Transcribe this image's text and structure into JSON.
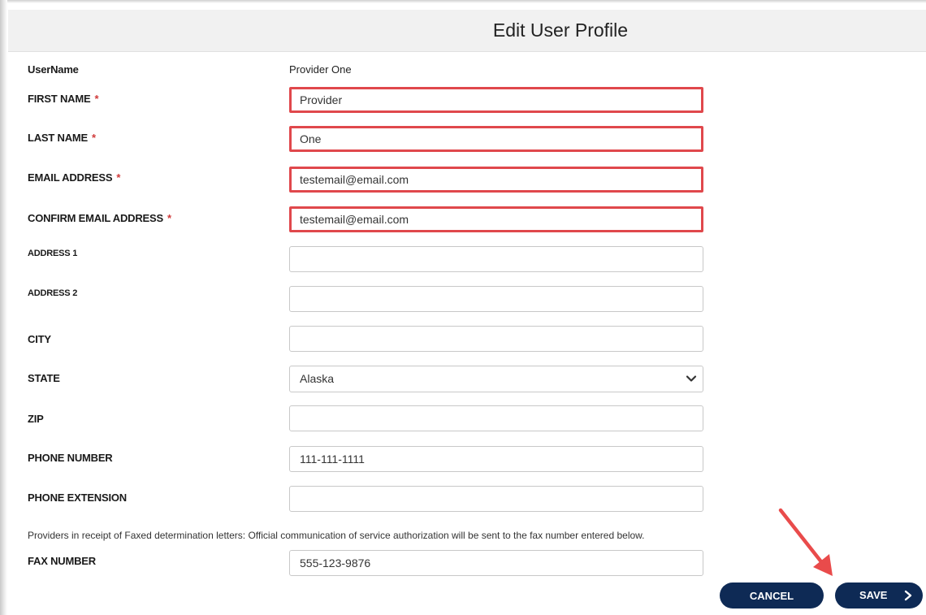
{
  "header": {
    "title": "Edit User Profile"
  },
  "form": {
    "username": {
      "label": "UserName",
      "value": "Provider One"
    },
    "first_name": {
      "label": "FIRST NAME",
      "required_mark": "*",
      "value": "Provider"
    },
    "last_name": {
      "label": "LAST NAME",
      "required_mark": "*",
      "value": "One"
    },
    "email": {
      "label": "EMAIL ADDRESS",
      "required_mark": "*",
      "value": "testemail@email.com"
    },
    "confirm_email": {
      "label": "CONFIRM EMAIL ADDRESS",
      "required_mark": "*",
      "value": "testemail@email.com"
    },
    "address1": {
      "label": "ADDRESS 1",
      "value": ""
    },
    "address2": {
      "label": "ADDRESS 2",
      "value": ""
    },
    "city": {
      "label": "CITY",
      "value": ""
    },
    "state": {
      "label": "STATE",
      "value": "Alaska"
    },
    "zip": {
      "label": "ZIP",
      "value": ""
    },
    "phone": {
      "label": "PHONE NUMBER",
      "value": "111-111-1111"
    },
    "phone_ext": {
      "label": "PHONE EXTENSION",
      "value": ""
    },
    "fax_note": "Providers in receipt of Faxed determination letters: Official communication of service authorization will be sent to the fax number entered below.",
    "fax": {
      "label": "FAX NUMBER",
      "value": "555-123-9876"
    }
  },
  "buttons": {
    "cancel": "CANCEL",
    "save": "SAVE"
  },
  "colors": {
    "highlight_border": "#e0484c",
    "button_bg": "#0e2a55",
    "required_mark": "#d03a3a",
    "annotation_arrow": "#e94b4b"
  },
  "icons": {
    "state_dropdown": "chevron-down-icon",
    "save_button": "chevron-right-icon",
    "annotation": "red-arrow-icon"
  }
}
